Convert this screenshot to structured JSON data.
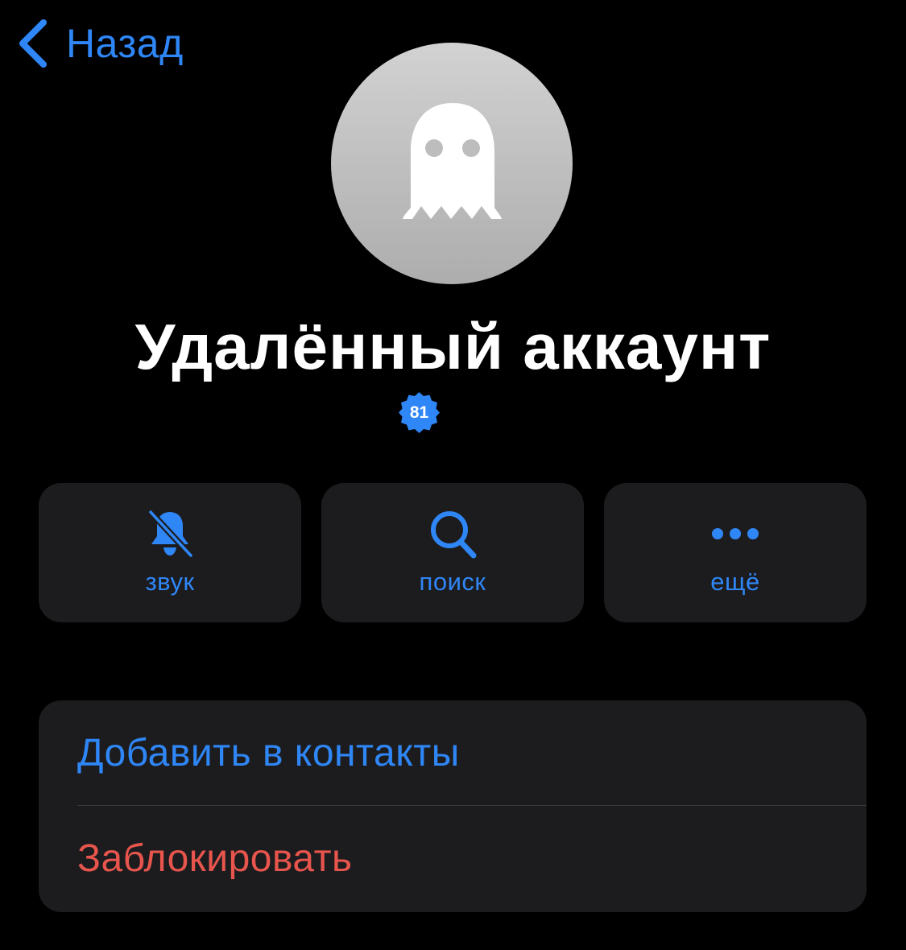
{
  "nav": {
    "back_label": "Назад",
    "back_icon": "chevron-left-icon"
  },
  "profile": {
    "avatar_icon": "ghost-icon",
    "name": "Удалённый аккаунт",
    "badge_value": "81"
  },
  "actions": [
    {
      "label": "звук",
      "icon": "bell-slash-icon"
    },
    {
      "label": "поиск",
      "icon": "search-icon"
    },
    {
      "label": "ещё",
      "icon": "ellipsis-icon"
    }
  ],
  "options": [
    {
      "label": "Добавить в контакты",
      "color": "#2f86f6"
    },
    {
      "label": "Заблокировать",
      "color": "#e7554d"
    }
  ],
  "colors": {
    "accent": "#2f86f6",
    "destructive": "#e7554d",
    "background": "#000000",
    "card": "#1c1c1e"
  }
}
